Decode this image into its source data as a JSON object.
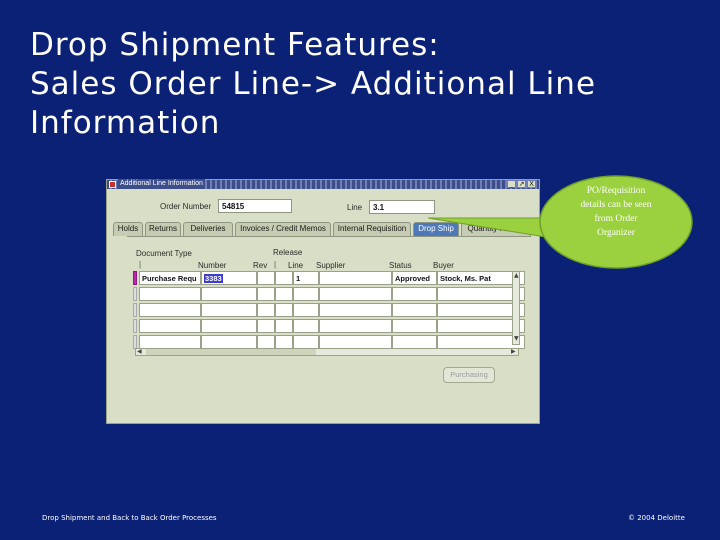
{
  "slide": {
    "title_lines": [
      "Drop Shipment Features:",
      "Sales Order Line-> Additional Line",
      "Information"
    ],
    "footer_left": "Drop Shipment and Back to Back Order Processes",
    "footer_right": "© 2004 Deloitte"
  },
  "window": {
    "title": "Additional Line Information",
    "controls": [
      "_",
      "↗",
      "X"
    ],
    "order_number_label": "Order Number",
    "order_number_value": "54815",
    "line_label": "Line",
    "line_value": "3.1",
    "tabs": [
      {
        "label": "Holds",
        "active": false
      },
      {
        "label": "Returns",
        "active": false
      },
      {
        "label": "Deliveries",
        "active": false
      },
      {
        "label": "Invoices / Credit Memos",
        "active": false
      },
      {
        "label": "Internal Requisition",
        "active": false
      },
      {
        "label": "Drop Ship",
        "active": true
      },
      {
        "label": "Quantity History",
        "active": false
      }
    ],
    "group_header": {
      "document_type": "Document Type",
      "release": "Release"
    },
    "columns": [
      "Number",
      "Rev",
      "Line",
      "Supplier",
      "Status",
      "Buyer"
    ],
    "rows": [
      {
        "document_type": "Purchase Requ",
        "number": "3383",
        "rev": "",
        "line": "1",
        "supplier": "",
        "status": "Approved",
        "buyer": "Stock, Ms. Pat"
      }
    ],
    "purchasing_button": "Purchasing"
  },
  "callout": {
    "text_lines": [
      "PO/Requisition",
      "details can be seen",
      "from Order",
      "Organizer"
    ],
    "fill_color": "#9bd13f"
  },
  "colors": {
    "background": "#0b2175",
    "active_tab": "#4f78b8",
    "selection": "#3d3dd0",
    "row_marker": "#c026b0"
  }
}
